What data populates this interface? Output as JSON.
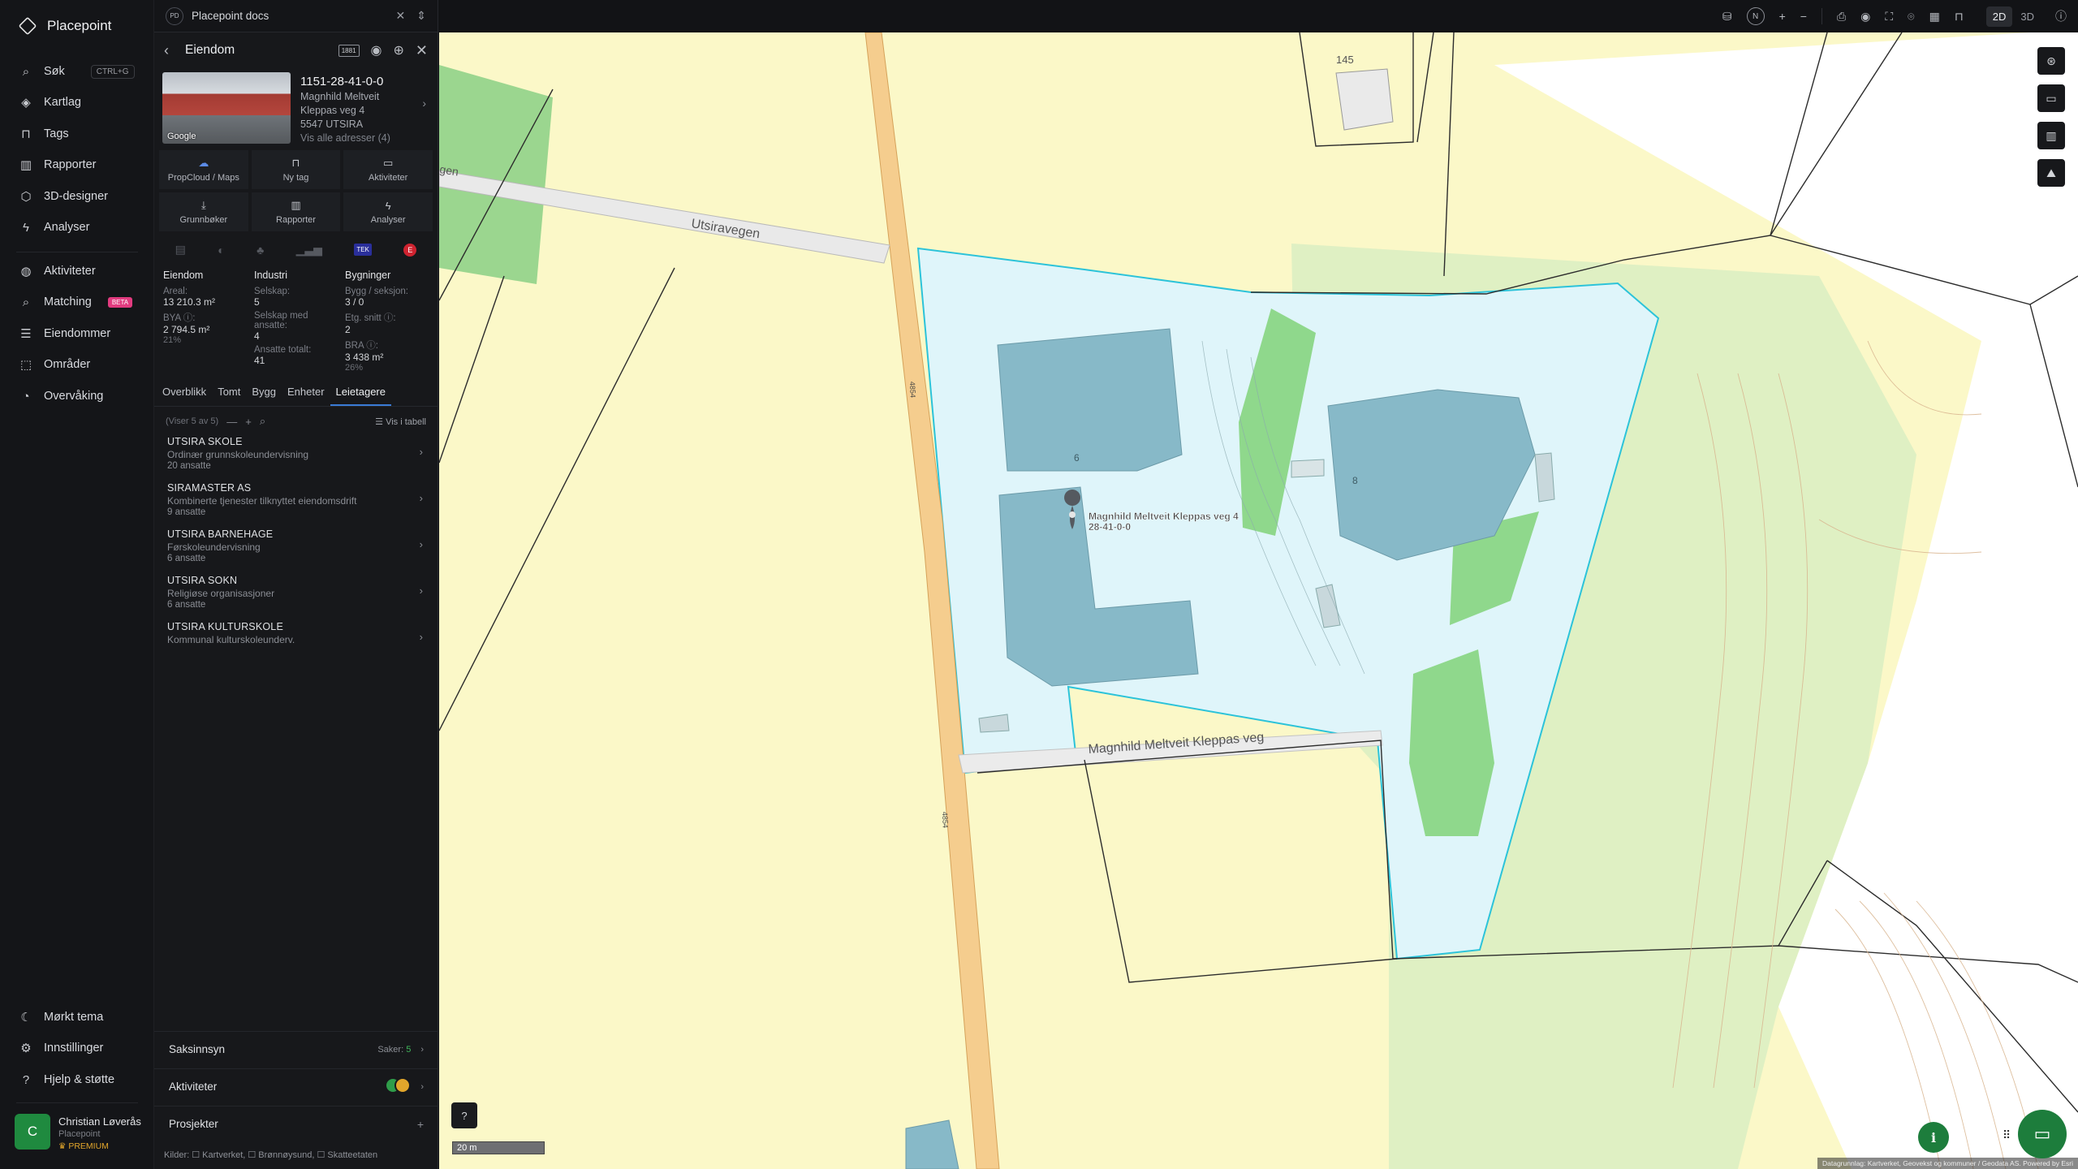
{
  "nav": {
    "brand": "Placepoint",
    "items_top": [
      {
        "label": "Søk",
        "icon": "search-icon",
        "shortcut": "CTRL+G"
      },
      {
        "label": "Kartlag",
        "icon": "layers-icon"
      },
      {
        "label": "Tags",
        "icon": "bookmark-icon"
      },
      {
        "label": "Rapporter",
        "icon": "chart-icon"
      },
      {
        "label": "3D-designer",
        "icon": "cube-icon"
      },
      {
        "label": "Analyser",
        "icon": "bolt-icon"
      }
    ],
    "items_mid": [
      {
        "label": "Aktiviteter",
        "icon": "activity-icon"
      },
      {
        "label": "Matching",
        "icon": "matching-icon",
        "badge": "BETA"
      },
      {
        "label": "Eiendommer",
        "icon": "list-icon"
      },
      {
        "label": "Områder",
        "icon": "area-icon"
      },
      {
        "label": "Overvåking",
        "icon": "monitor-icon"
      }
    ],
    "items_bottom": [
      {
        "label": "Mørkt tema",
        "icon": "moon-icon"
      },
      {
        "label": "Innstillinger",
        "icon": "gear-icon"
      },
      {
        "label": "Hjelp & støtte",
        "icon": "help-icon"
      }
    ],
    "user": {
      "initial": "C",
      "name": "Christian Løverås",
      "org": "Placepoint",
      "plan": "PREMIUM"
    }
  },
  "panel": {
    "docs_badge": "PD",
    "docs_title": "Placepoint docs",
    "header_title": "Eiendom",
    "header_tag": "1881",
    "property": {
      "id": "1151-28-41-0-0",
      "owner": "Magnhild Meltveit",
      "address": "Kleppas veg 4",
      "postal": "5547 UTSIRA",
      "all_addresses": "Vis alle adresser (4)",
      "photo_label": "Google"
    },
    "actions": [
      {
        "label": "PropCloud / Maps",
        "icon": "cloud-icon"
      },
      {
        "label": "Ny tag",
        "icon": "bookmark-icon"
      },
      {
        "label": "Aktiviteter",
        "icon": "activity-icon"
      },
      {
        "label": "Grunnbøker",
        "icon": "download-icon"
      },
      {
        "label": "Rapporter",
        "icon": "chart-icon"
      },
      {
        "label": "Analyser",
        "icon": "bolt-icon"
      }
    ],
    "sources": {
      "tek": "TEK",
      "e": "E"
    },
    "stats": {
      "col1": {
        "title": "Eiendom",
        "rows": [
          {
            "k": "Areal:",
            "v": "13 210.3 m²"
          },
          {
            "k": "BYA ⓘ:",
            "v": "2 794.5 m²",
            "pct": "21%"
          }
        ]
      },
      "col2": {
        "title": "Industri",
        "rows": [
          {
            "k": "Selskap:",
            "v": "5"
          },
          {
            "k": "Selskap med ansatte:",
            "v": "4"
          },
          {
            "k": "Ansatte totalt:",
            "v": "41"
          }
        ]
      },
      "col3": {
        "title": "Bygninger",
        "rows": [
          {
            "k": "Bygg / seksjon:",
            "v": "3 / 0"
          },
          {
            "k": "Etg. snitt ⓘ:",
            "v": "2"
          },
          {
            "k": "BRA ⓘ:",
            "v": "3 438 m²",
            "pct": "26%"
          }
        ]
      }
    },
    "tabs": [
      "Overblikk",
      "Tomt",
      "Bygg",
      "Enheter",
      "Leietagere"
    ],
    "active_tab": "Leietagere",
    "list_count": "(Viser 5 av 5)",
    "list_table": "Vis i tabell",
    "tenants": [
      {
        "name": "UTSIRA SKOLE",
        "desc": "Ordinær grunnskoleundervisning",
        "count": "20 ansatte"
      },
      {
        "name": "SIRAMASTER AS",
        "desc": "Kombinerte tjenester tilknyttet eiendomsdrift",
        "count": "9 ansatte"
      },
      {
        "name": "UTSIRA BARNEHAGE",
        "desc": "Førskoleundervisning",
        "count": "6 ansatte"
      },
      {
        "name": "UTSIRA SOKN",
        "desc": "Religiøse organisasjoner",
        "count": "6 ansatte"
      },
      {
        "name": "UTSIRA KULTURSKOLE",
        "desc": "Kommunal kulturskoleunderv.",
        "count": ""
      }
    ],
    "sections": {
      "saksinnsyn": "Saksinnsyn",
      "saker_label": "Saker:",
      "saker_value": "5",
      "aktiviteter": "Aktiviteter",
      "prosjekter": "Prosjekter"
    },
    "sources_line": "Kilder: ☐ Kartverket, ☐ Brønnøysund, ☐ Skatteetaten"
  },
  "map": {
    "view_2d": "2D",
    "view_3d": "3D",
    "north": "N",
    "labels": {
      "road1": "Utsiravegen",
      "road2": "Magnhild Meltveit Kleppas veg",
      "road1_cut": "gen",
      "marker_line1": "Magnhild Meltveit Kleppas veg 4",
      "marker_line2": "28-41-0-0",
      "num145": "145",
      "num6": "6",
      "num8": "8",
      "road_no1": "4854",
      "road_no2": "4854"
    },
    "scale": "20 m",
    "attribution": "Datagrunnlag: Kartverket, Geovekst og kommuner / Geodata AS. Powered by Esri"
  }
}
